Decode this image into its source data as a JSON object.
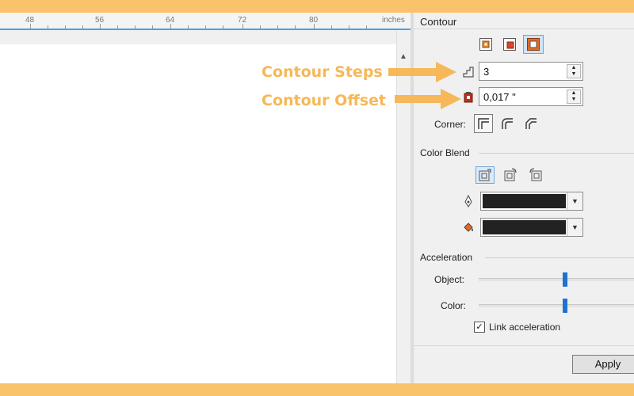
{
  "ruler": {
    "ticks": [
      "48",
      "56",
      "64",
      "72",
      "80"
    ],
    "units": "inches"
  },
  "panel": {
    "title": "Contour",
    "mode_icons": [
      "contour-to-center-icon",
      "contour-inside-icon",
      "contour-outside-icon"
    ],
    "steps": {
      "icon": "contour-steps-icon",
      "value": "3"
    },
    "offset": {
      "icon": "contour-offset-icon",
      "value": "0,017 \""
    },
    "corner": {
      "label": "Corner:",
      "icons": [
        "mitered-corner-icon",
        "round-corner-icon",
        "bevel-corner-icon"
      ]
    },
    "color_blend": {
      "label": "Color Blend",
      "icons": [
        "linear-color-blend-icon",
        "clockwise-color-blend-icon",
        "counterclockwise-color-blend-icon"
      ],
      "outline_color_icon": "outline-pen-icon",
      "fill_color_icon": "fill-bucket-icon",
      "outline_color": "#222222",
      "fill_color": "#222222"
    },
    "acceleration": {
      "label": "Acceleration",
      "object_label": "Object:",
      "color_label": "Color:",
      "object_value": 0.56,
      "color_value": 0.56
    },
    "link_acceleration": {
      "label": "Link acceleration",
      "checked": true
    },
    "apply_label": "Apply"
  },
  "annotations": {
    "steps_label": "Contour Steps",
    "offset_label": "Contour Offset",
    "color": "#f6b858"
  }
}
